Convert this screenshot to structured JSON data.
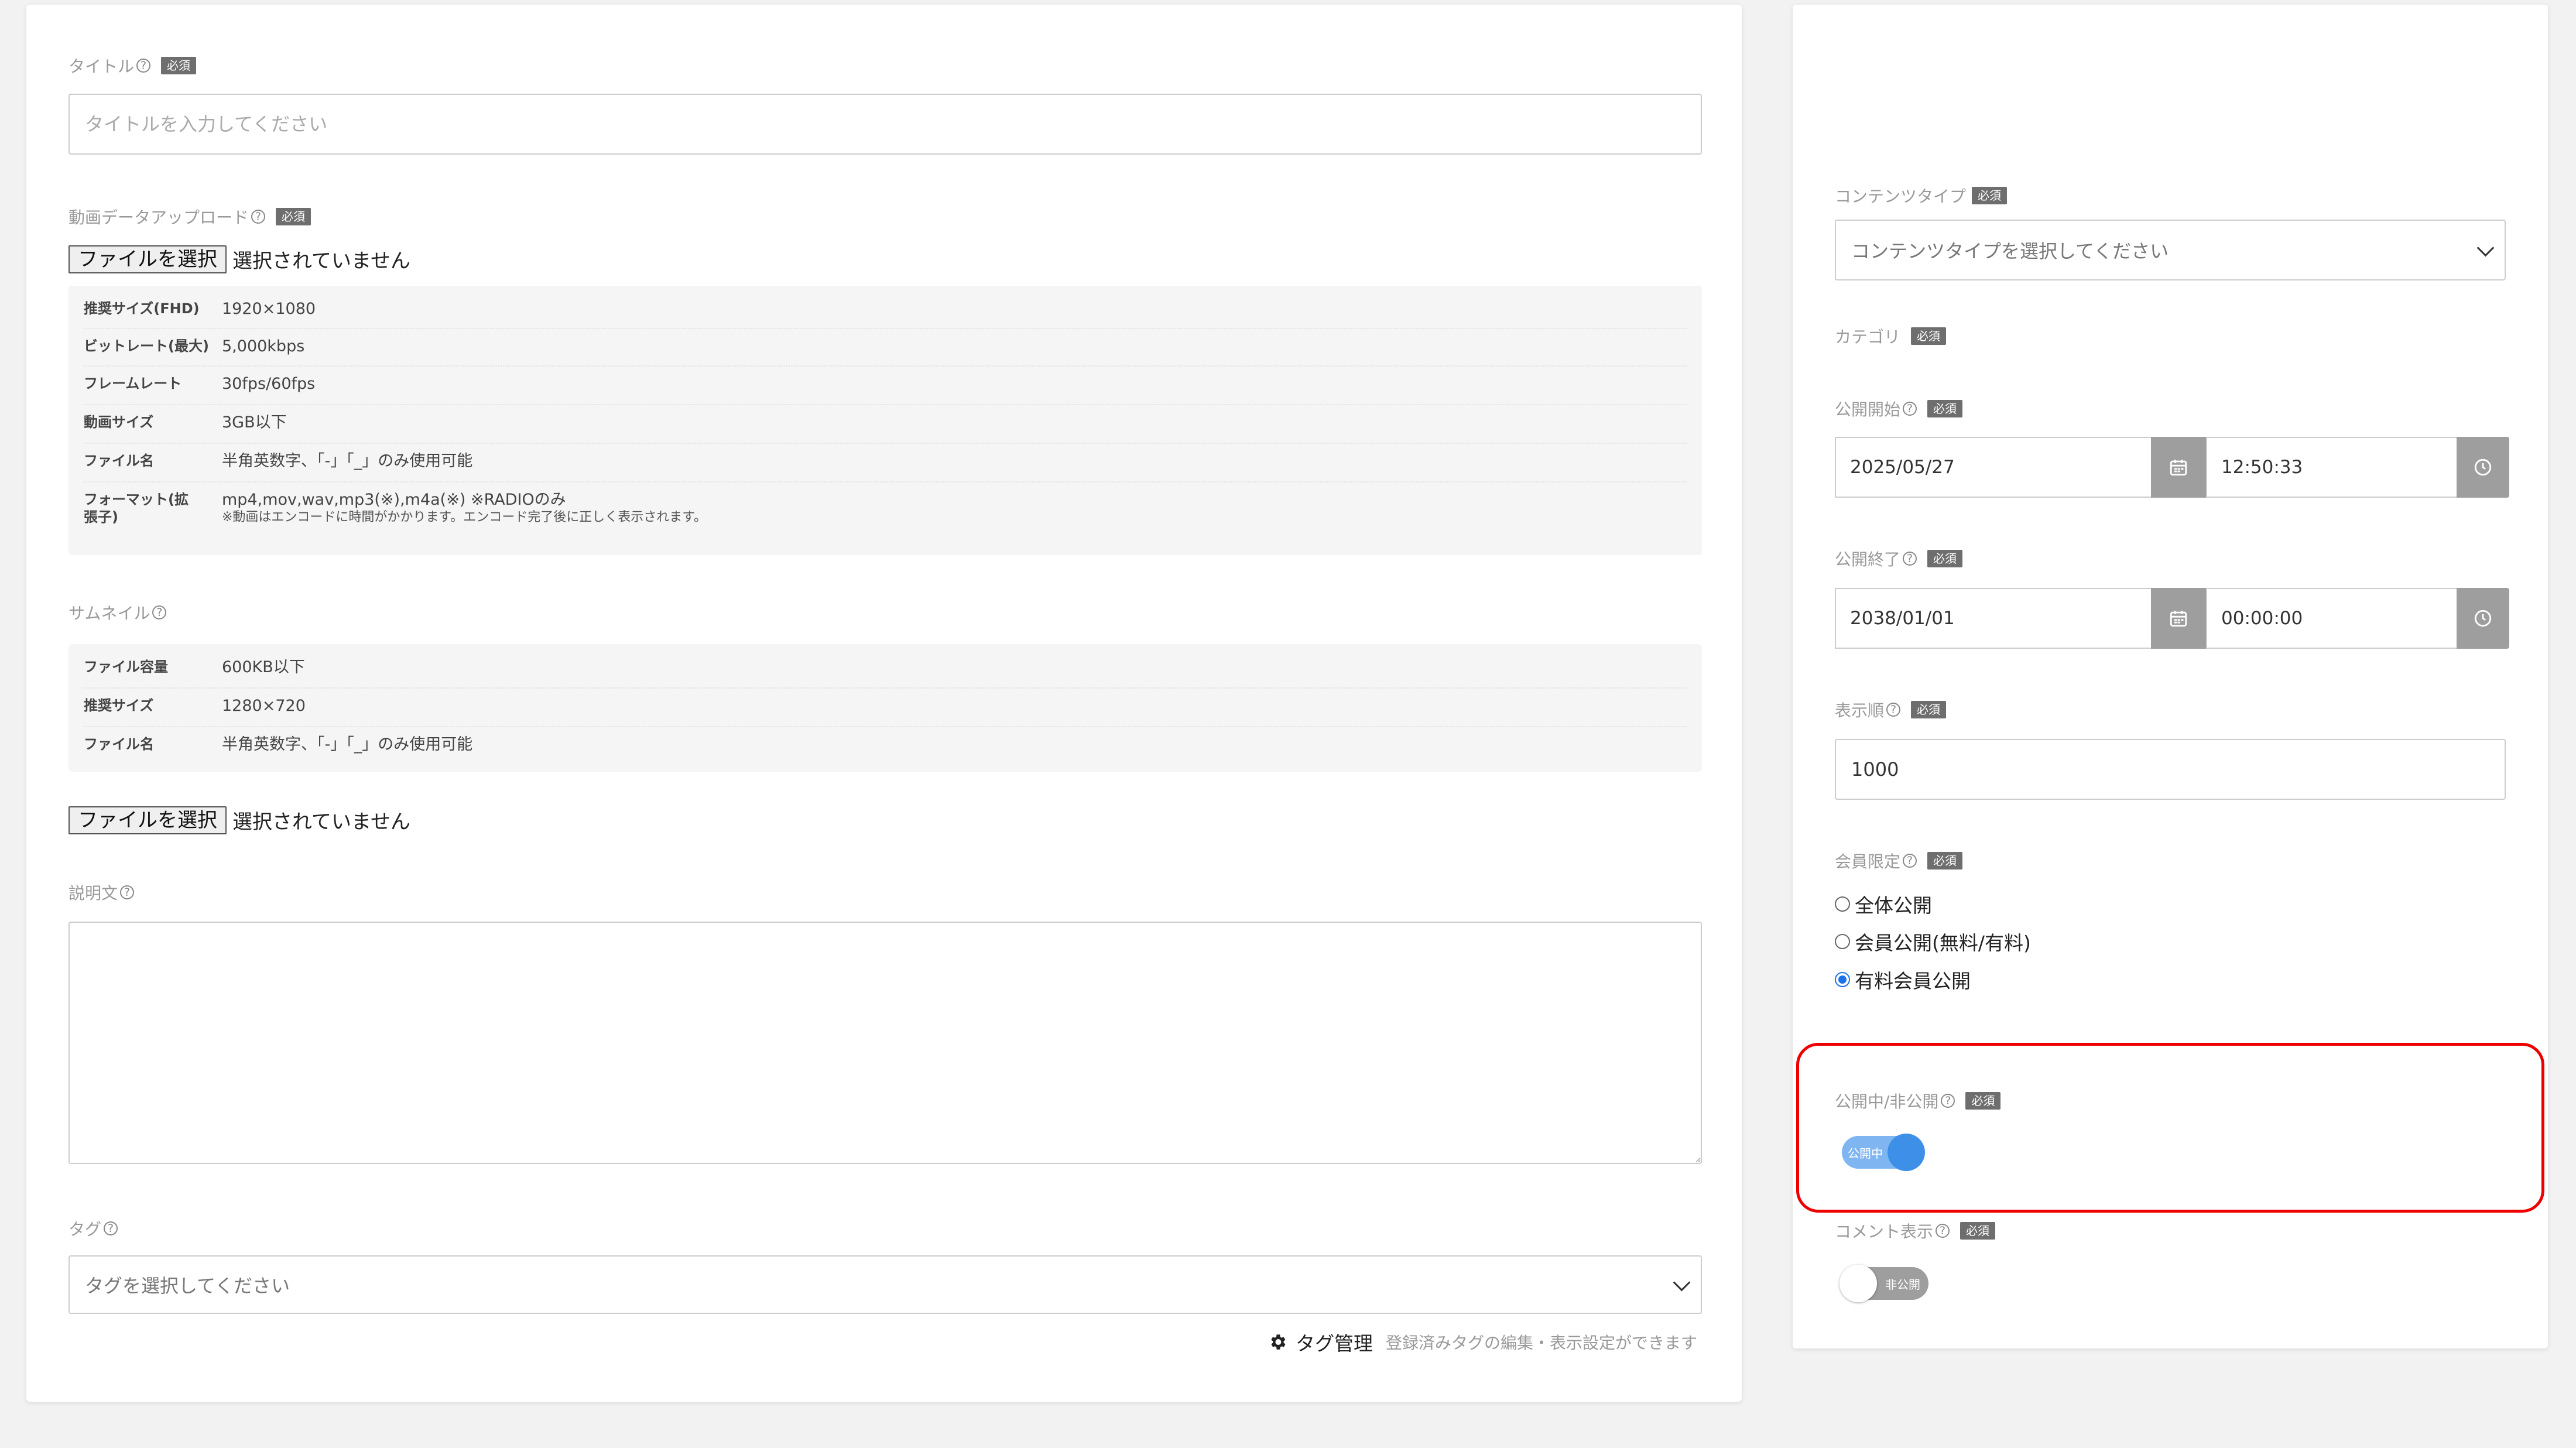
{
  "left": {
    "title": {
      "label": "タイトル",
      "required": "必須",
      "placeholder": "タイトルを入力してください"
    },
    "video_upload": {
      "label": "動画データアップロード",
      "required": "必須",
      "file_button": "ファイルを選択",
      "file_status": "選択されていません",
      "specs": [
        {
          "key": "推奨サイズ(FHD)",
          "value": "1920×1080"
        },
        {
          "key": "ビットレート(最大)",
          "value": "5,000kbps"
        },
        {
          "key": "フレームレート",
          "value": "30fps/60fps"
        },
        {
          "key": "動画サイズ",
          "value": "3GB以下"
        },
        {
          "key": "ファイル名",
          "value": "半角英数字、「-」「_」のみ使用可能"
        },
        {
          "key": "フォーマット(拡張子)",
          "value": "mp4,mov,wav,mp3(※),m4a(※) ※RADIOのみ",
          "note": "※動画はエンコードに時間がかかります。エンコード完了後に正しく表示されます。"
        }
      ]
    },
    "thumbnail": {
      "label": "サムネイル",
      "specs": [
        {
          "key": "ファイル容量",
          "value": "600KB以下"
        },
        {
          "key": "推奨サイズ",
          "value": "1280×720"
        },
        {
          "key": "ファイル名",
          "value": "半角英数字、「-」「_」のみ使用可能"
        }
      ],
      "file_button": "ファイルを選択",
      "file_status": "選択されていません"
    },
    "description": {
      "label": "説明文"
    },
    "tags": {
      "label": "タグ",
      "placeholder": "タグを選択してください",
      "manage_label": "タグ管理",
      "manage_hint": "登録済みタグの編集・表示設定ができます"
    }
  },
  "right": {
    "content_type": {
      "label": "コンテンツタイプ",
      "required": "必須",
      "placeholder": "コンテンツタイプを選択してください"
    },
    "category": {
      "label": "カテゴリ",
      "required": "必須"
    },
    "publish_start": {
      "label": "公開開始",
      "required": "必須",
      "date": "2025/05/27",
      "time": "12:50:33"
    },
    "publish_end": {
      "label": "公開終了",
      "required": "必須",
      "date": "2038/01/01",
      "time": "00:00:00"
    },
    "display_order": {
      "label": "表示順",
      "required": "必須",
      "value": "1000"
    },
    "membership": {
      "label": "会員限定",
      "required": "必須",
      "options": [
        "全体公開",
        "会員公開(無料/有料)",
        "有料会員公開"
      ],
      "selected": "有料会員公開"
    },
    "visibility": {
      "label": "公開中/非公開",
      "required": "必須",
      "toggle_label": "公開中",
      "on": true
    },
    "comment_display": {
      "label": "コメント表示",
      "required": "必須",
      "toggle_label": "非公開",
      "on": false
    }
  },
  "colors": {
    "toggle_on": "#3d8fe8",
    "highlight": "#e00000",
    "required_badge": "#6e6e6e"
  }
}
